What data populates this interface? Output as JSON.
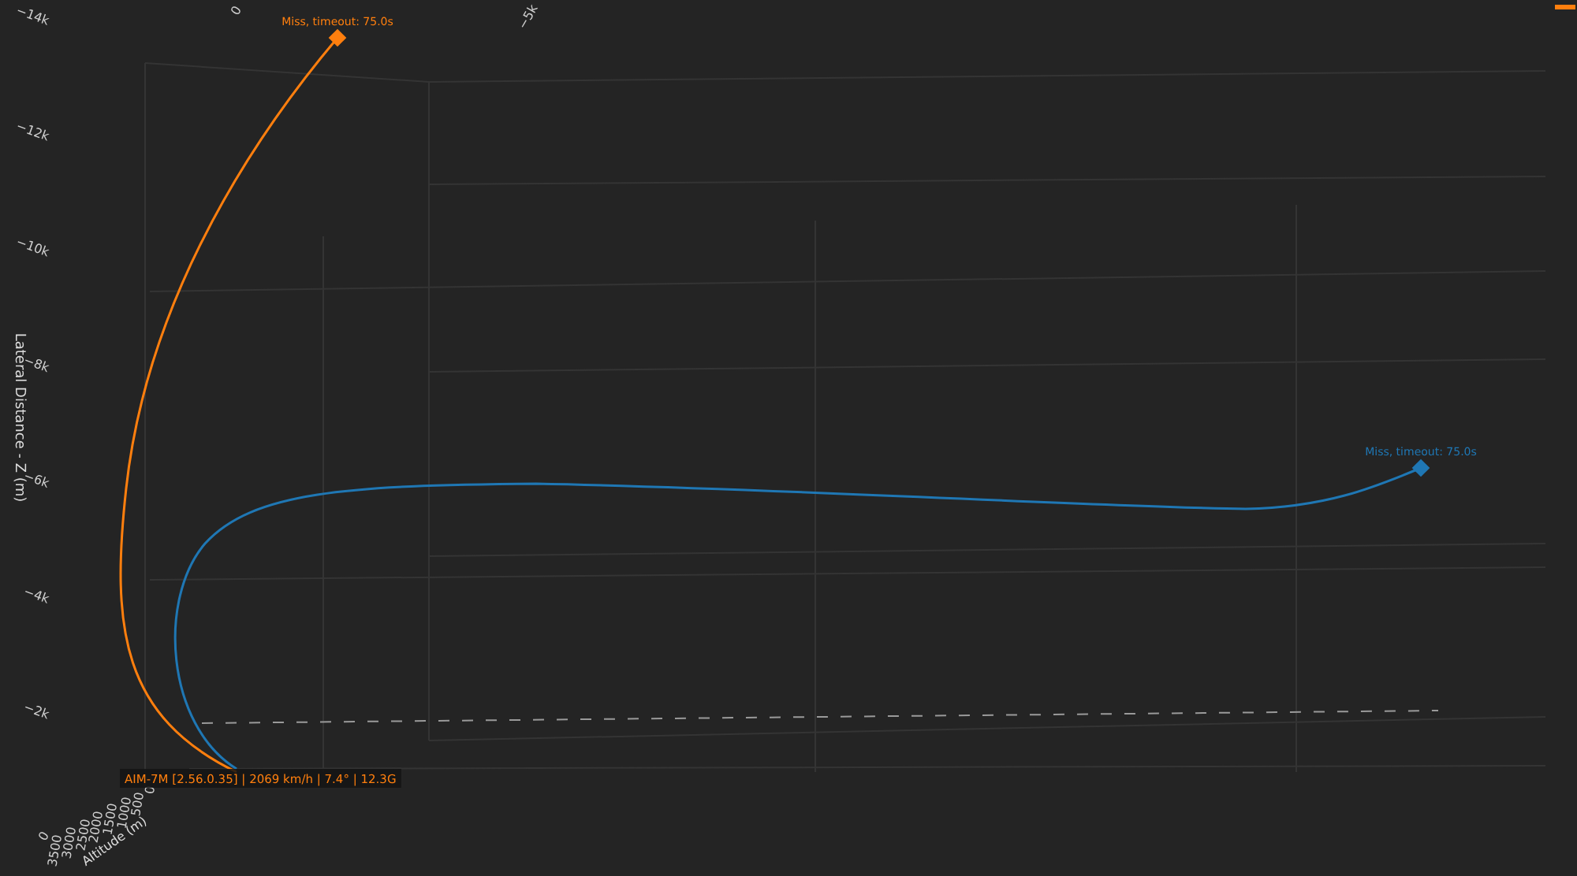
{
  "chart": {
    "x_axis": {
      "ticks": [
        "0",
        "−5k"
      ]
    },
    "corner_tick": "0",
    "z_axis": {
      "title": "Lateral Distance - Z (m)",
      "ticks": [
        "−14k",
        "−12k",
        "−10k",
        "−8k",
        "−6k",
        "−4k",
        "−2k"
      ]
    },
    "altitude_axis": {
      "title": "Altitude (m)",
      "ticks": [
        "0",
        "500",
        "1000",
        "1500",
        "2000",
        "2500",
        "3000",
        "3500"
      ]
    },
    "traces": [
      {
        "color": "#ff7f0e",
        "end_label": "Miss, timeout: 75.0s"
      },
      {
        "color": "#1f77b4",
        "end_label": "Miss, timeout: 75.0s"
      }
    ],
    "hover_label": {
      "text": "AIM-7M [2.56.0.35] | 2069 km/h | 7.4° | 12.3G",
      "color": "#ff7f0e"
    },
    "legend": [
      {
        "color": "#ff7f0e"
      }
    ]
  }
}
